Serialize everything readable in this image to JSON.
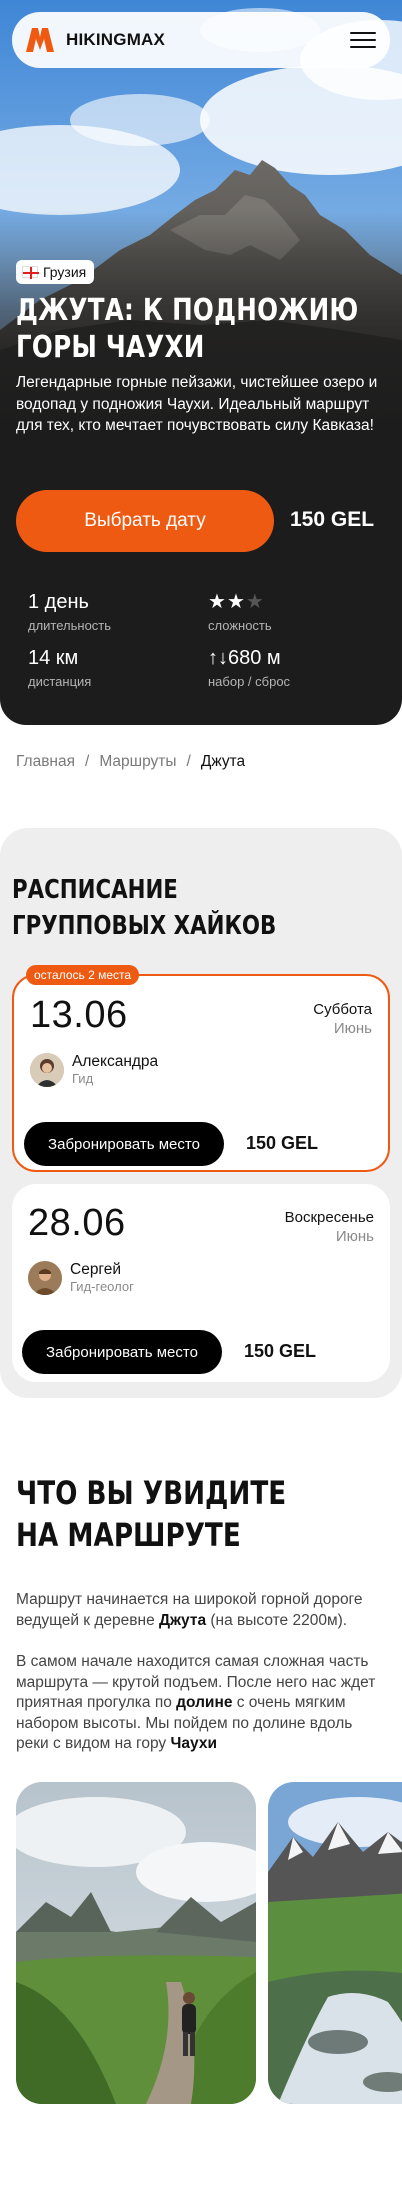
{
  "header": {
    "logo_text": "HIKINGMAX",
    "menu_icon": "hamburger-menu-icon"
  },
  "hero": {
    "country": "Грузия",
    "title_line1": "ДЖУТА: К ПОДНОЖИЮ",
    "title_line2": "ГОРЫ ЧАУХИ",
    "description": "Легендарные горные пейзажи, чистейшее озеро и водопад у подножия Чаухи. Идеальный маршрут для тех, кто мечтает почувствовать силу Кавказа!",
    "cta_label": "Выбрать дату",
    "price": "150 GEL",
    "stats": {
      "duration_value": "1 день",
      "duration_label": "длительность",
      "difficulty_label": "сложность",
      "difficulty_level": 2,
      "difficulty_max": 3,
      "distance_value": "14 км",
      "distance_label": "дистанция",
      "elevation_value": "↑↓680 м",
      "elevation_label": "набор / сброс"
    }
  },
  "breadcrumb": {
    "items": [
      "Главная",
      "Маршруты"
    ],
    "separator": "/",
    "current": "Джута"
  },
  "schedule": {
    "title_line1": "РАСПИСАНИЕ",
    "title_line2": "ГРУППОВЫХ ХАЙКОВ",
    "cards": [
      {
        "badge": "осталось 2 места",
        "date": "13.06",
        "weekday": "Суббота",
        "month": "Июнь",
        "guide_name": "Александра",
        "guide_role": "Гид",
        "book_label": "Забронировать место",
        "price": "150 GEL"
      },
      {
        "date": "28.06",
        "weekday": "Воскресенье",
        "month": "Июнь",
        "guide_name": "Сергей",
        "guide_role": "Гид-геолог",
        "book_label": "Забронировать место",
        "price": "150 GEL"
      }
    ]
  },
  "route": {
    "title_line1": "ЧТО ВЫ УВИДИТЕ",
    "title_line2": "НА МАРШРУТЕ",
    "p1_a": "Маршрут начинается на широкой горной дороге ведущей к деревне ",
    "p1_b": "Джута",
    "p1_c": " (на высоте 2200м).",
    "p2_a": "В самом начале находится самая сложная часть маршрута — крутой подъем. После него нас ждет приятная прогулка по ",
    "p2_b": "долине",
    "p2_c": " с очень мягким набором высоты. Мы пойдем по долине вдоль реки с видом на гору ",
    "p2_d": "Чаухи"
  },
  "colors": {
    "accent": "#ee5a12",
    "hero_bg": "#1c1c1c",
    "schedule_bg": "#eeeeee"
  }
}
